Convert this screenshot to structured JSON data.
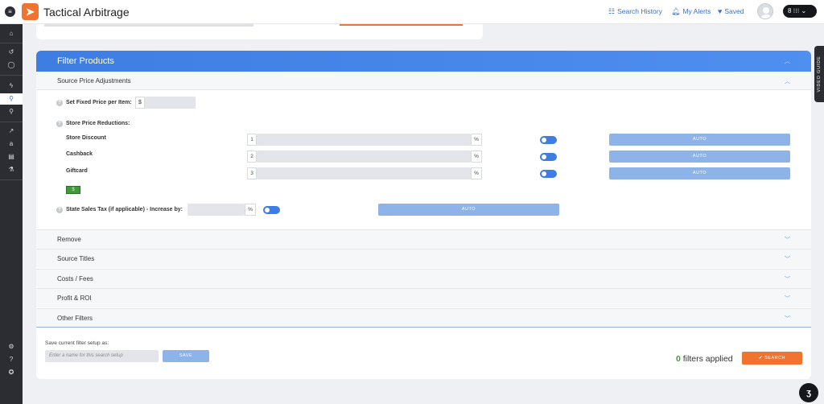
{
  "app": {
    "title": "Tactical Arbitrage"
  },
  "topnav": {
    "search_history": "Search History",
    "my_alerts": "My Alerts",
    "saved": "Saved",
    "account_short": "8 ⁝⁝⁝ ⌄"
  },
  "top_card": {},
  "panel": {
    "title": "Filter Products",
    "source_price": {
      "label": "Source Price Adjustments",
      "fixed_price_label": "Set Fixed Price per Item:",
      "currency_symbol": "$",
      "reductions_label": "Store Price Reductions:",
      "rows": [
        {
          "label": "Store Discount",
          "num": "1",
          "unit": "%",
          "auto": "AUTO"
        },
        {
          "label": "Cashback",
          "num": "2",
          "unit": "%",
          "auto": "AUTO"
        },
        {
          "label": "Giftcard",
          "num": "3",
          "unit": "%",
          "auto": "AUTO"
        }
      ],
      "sales_tax_label": "State Sales Tax (if applicable) - Increase by:",
      "sales_tax_unit": "%",
      "sales_tax_auto": "AUTO"
    },
    "sections": [
      "Remove",
      "Source Titles",
      "Costs / Fees",
      "Profit & ROI",
      "Other Filters"
    ],
    "save": {
      "label": "Save current filter setup as:",
      "placeholder": "Enter a name for this search setup",
      "button": "SAVE"
    },
    "filters_applied_count": "0",
    "filters_applied_text": "filters applied",
    "search_button": "✔ SEARCH"
  },
  "video_guide": "VIDEO GUIDE",
  "colors": {
    "accent": "#3e7de2",
    "brand_orange": "#f0742f",
    "sidebar": "#2b2d33",
    "success": "#3f9a3a"
  },
  "icons": [
    "menu-icon",
    "logo-icon",
    "search-icon",
    "bell-icon",
    "heart-icon",
    "avatar",
    "home-icon",
    "chat-icon"
  ]
}
